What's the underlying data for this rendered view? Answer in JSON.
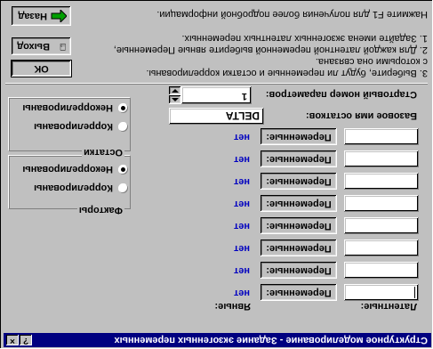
{
  "window": {
    "title": "Структурное моделирование - Задание экзогенных переменных",
    "help_glyph": "?",
    "close_glyph": "×"
  },
  "instructions": [
    "Нажмите F1 для получения более подробной информации.",
    "1. Задайте имена экзогенных латентных переменных.",
    "2. Для каждой латентной переменной выберите явные Переменные,",
    "    с которыми она связана.",
    "3. Выберите, будут ли переменные и остатки коррелированы."
  ],
  "buttons": {
    "back": "Назад",
    "exit": "Выход",
    "ok": "OK"
  },
  "start_param": {
    "label": "Стартовый номер параметров:",
    "value": "1"
  },
  "base_name": {
    "label": "Базовое имя остатков:",
    "value": "DELTA"
  },
  "rows": [
    {
      "button": "Переменные:",
      "status": "нет"
    },
    {
      "button": "Переменные:",
      "status": "нет"
    },
    {
      "button": "Переменные:",
      "status": "нет"
    },
    {
      "button": "Переменные:",
      "status": "нет"
    },
    {
      "button": "Переменные:",
      "status": "нет"
    },
    {
      "button": "Переменные:",
      "status": "нет"
    },
    {
      "button": "Переменные:",
      "status": "нет"
    },
    {
      "button": "Переменные:",
      "status": "нет"
    }
  ],
  "column_headers": {
    "latent": "Латентные:",
    "manifest": "Явные:"
  },
  "residuals_group": {
    "title": "Остатки",
    "options": [
      "Некоррелированы",
      "Коррелированы"
    ],
    "selected": 0
  },
  "factors_group": {
    "title": "Факторы",
    "options": [
      "Некоррелированы",
      "Коррелированы"
    ],
    "selected": 0
  },
  "colors": {
    "title_bar": "#000080",
    "status_text": "#0000c0",
    "arrow_green": "#00a000"
  }
}
